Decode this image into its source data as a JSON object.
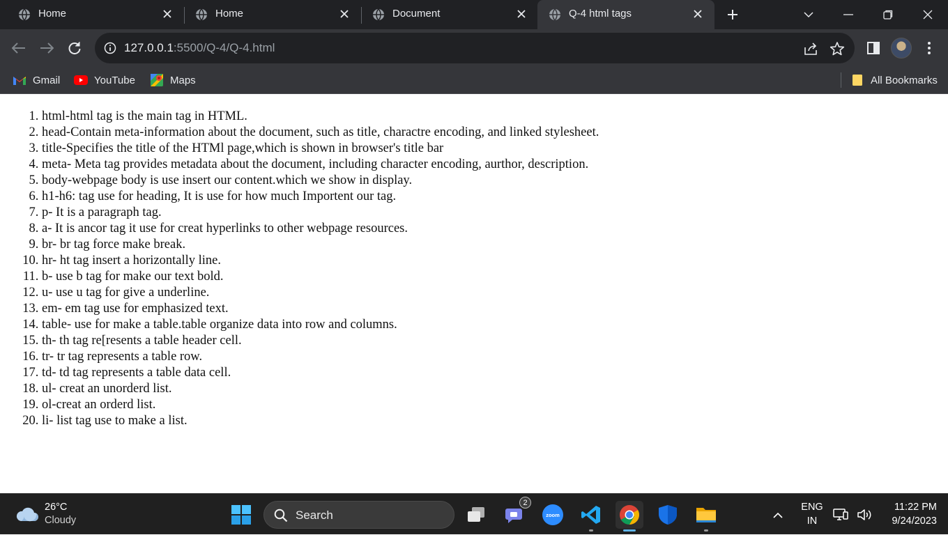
{
  "browser": {
    "tabs": [
      {
        "title": "Home",
        "active": false
      },
      {
        "title": "Home",
        "active": false
      },
      {
        "title": "Document",
        "active": false
      },
      {
        "title": "Q-4 html tags",
        "active": true
      }
    ],
    "url_host": "127.0.0.1",
    "url_rest": ":5500/Q-4/Q-4.html",
    "bookmarks": [
      {
        "label": "Gmail",
        "icon": "gmail-icon"
      },
      {
        "label": "YouTube",
        "icon": "youtube-icon"
      },
      {
        "label": "Maps",
        "icon": "maps-icon"
      }
    ],
    "all_bookmarks_label": "All Bookmarks"
  },
  "page": {
    "items": [
      "html-html tag is the main tag in HTML.",
      "head-Contain meta-information about the document, such as title, charactre encoding, and linked stylesheet.",
      "title-Specifies the title of the HTMl page,which is shown in browser's title bar",
      "meta- Meta tag provides metadata about the document, including character encoding, aurthor, description.",
      "body-webpage body is use insert our content.which we show in display.",
      "h1-h6: tag use for heading, It is use for how much Importent our tag.",
      "p- It is a paragraph tag.",
      "a- It is ancor tag it use for creat hyperlinks to other webpage resources.",
      "br- br tag force make break.",
      "hr- ht tag insert a horizontally line.",
      "b- use b tag for make our text bold.",
      "u- use u tag for give a underline.",
      "em- em tag use for emphasized text.",
      "table- use for make a table.table organize data into row and columns.",
      "th- th tag re[resents a table header cell.",
      "tr- tr tag represents a table row.",
      "td- td tag represents a table data cell.",
      "ul- creat an unorderd list.",
      "ol-creat an orderd list.",
      "li- list tag use to make a list."
    ]
  },
  "taskbar": {
    "weather_temp": "26°C",
    "weather_cond": "Cloudy",
    "search_label": "Search",
    "teams_badge": "2",
    "zoom_label": "zoom",
    "lang_top": "ENG",
    "lang_bottom": "IN",
    "time": "11:22 PM",
    "date": "9/24/2023"
  },
  "colors": {
    "tab_strip": "#202124",
    "toolbar": "#35363a",
    "taskbar": "#202020",
    "accent_blue": "#4cc2ff"
  }
}
